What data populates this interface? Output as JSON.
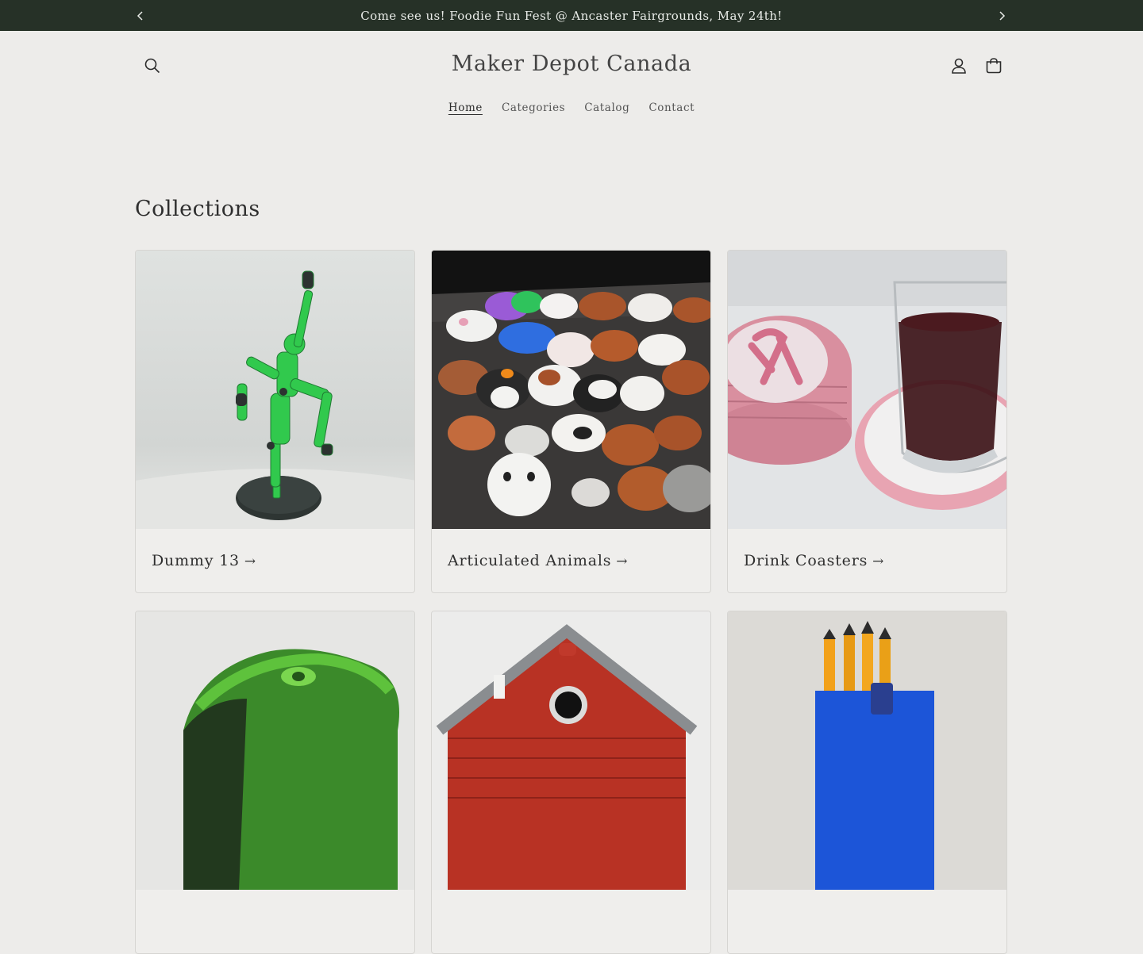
{
  "announcement": {
    "text": "Come see us! Foodie Fun Fest @ Ancaster Fairgrounds, May 24th!",
    "prev_icon": "chevron-left-icon",
    "next_icon": "chevron-right-icon"
  },
  "header": {
    "logo": "Maker Depot Canada",
    "icons": [
      "search-icon",
      "account-icon",
      "cart-icon"
    ]
  },
  "nav": {
    "items": [
      {
        "label": "Home",
        "active": true
      },
      {
        "label": "Categories",
        "active": false
      },
      {
        "label": "Catalog",
        "active": false
      },
      {
        "label": "Contact",
        "active": false
      }
    ]
  },
  "collections": {
    "title": "Collections",
    "arrow": "→",
    "cards": [
      {
        "title": "Dummy 13"
      },
      {
        "title": "Articulated Animals"
      },
      {
        "title": "Drink Coasters"
      },
      {
        "title": ""
      },
      {
        "title": ""
      },
      {
        "title": ""
      }
    ]
  },
  "colors": {
    "announcement_bg": "#263127",
    "page_bg": "#edecea",
    "text": "#2b2b2b"
  }
}
